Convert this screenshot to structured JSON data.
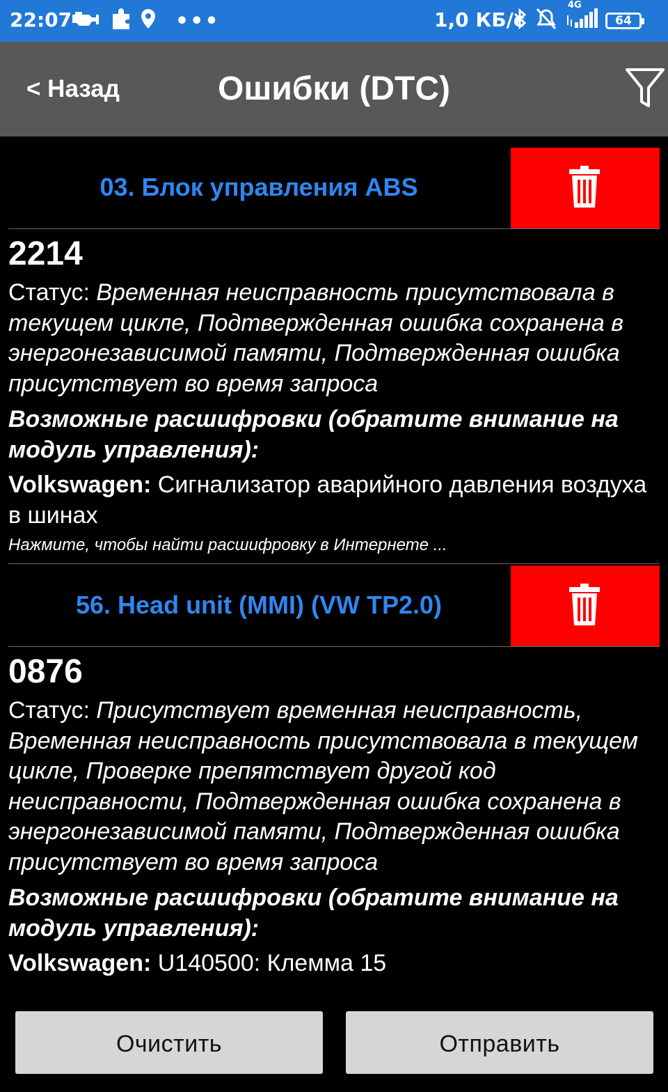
{
  "status_bar": {
    "time": "22:07",
    "speed": "1,0 КБ/с",
    "network": "4G",
    "battery": "64",
    "left_icons": [
      "engine-check-icon",
      "puzzle-icon",
      "location-pin-icon",
      "more-dots-icon"
    ],
    "right_icons": [
      "bluetooth-icon",
      "alarm-off-icon",
      "signal-icon",
      "battery-icon"
    ]
  },
  "header": {
    "back_label": "< Назад",
    "title": "Ошибки (DTC)",
    "filter_icon": "filter-icon"
  },
  "modules": [
    {
      "name": "03. Блок управления ABS",
      "dtcs": [
        {
          "code": "2214",
          "status_label": "Статус: ",
          "status_text": "Временная неисправность присутствовала в текущем цикле, Подтвержденная ошибка сохранена в энергонезависимой памяти, Подтвержденная ошибка присутствует во время запроса",
          "decode_title": "Возможные расшифровки (обратите внимание на модуль управления):",
          "decode_brand": "Volkswagen:",
          "decode_text": " Сигнализатор аварийного давления воздуха в шинах",
          "search_hint": "Нажмите, чтобы найти расшифровку в Интернете ..."
        }
      ]
    },
    {
      "name": "56. Head unit (MMI) (VW TP2.0)",
      "dtcs": [
        {
          "code": "0876",
          "status_label": "Статус: ",
          "status_text": "Присутствует временная неисправность, Временная неисправность присутствовала в текущем цикле, Проверке препятствует другой код неисправности, Подтвержденная ошибка сохранена в энергонезависимой памяти, Подтвержденная ошибка присутствует во время запроса",
          "decode_title": "Возможные расшифровки (обратите внимание на модуль управления):",
          "decode_brand": "Volkswagen:",
          "decode_text": " U140500: Клемма 15"
        }
      ]
    }
  ],
  "footer": {
    "clear_label": "Очистить",
    "send_label": "Отправить"
  },
  "colors": {
    "status_bar": "#2178d6",
    "title_bar": "#585858",
    "module_name": "#2f86f0",
    "delete_button": "#fe0000",
    "footer_button": "#d6d6d6"
  }
}
